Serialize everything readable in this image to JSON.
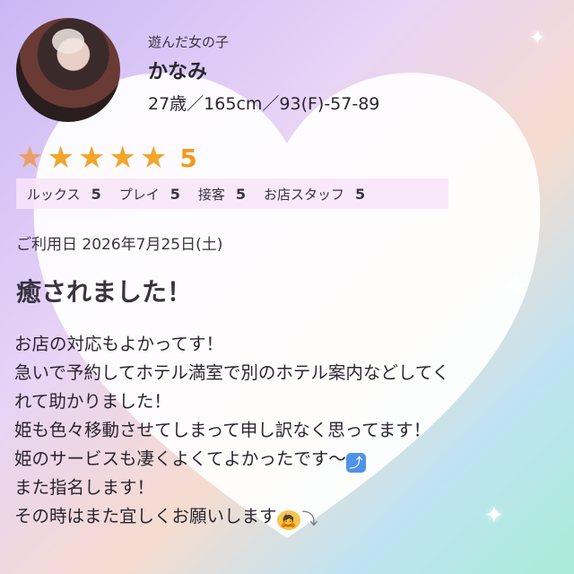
{
  "reviewer": {
    "label": "遊んだ女の子",
    "name": "かなみ",
    "profile": "27歳／165cm／93(F)-57-89"
  },
  "rating": {
    "stars": 5,
    "score": "5",
    "items": [
      {
        "label": "ルックス",
        "value": "5"
      },
      {
        "label": "プレイ",
        "value": "5"
      },
      {
        "label": "接客",
        "value": "5"
      },
      {
        "label": "お店スタッフ",
        "value": "5"
      }
    ]
  },
  "visit_date": "ご利用日 2026年7月25日(土)",
  "title": "癒されました！",
  "body": {
    "lines": [
      "お店の対応もよかってす！",
      "急いで予約してホテル満室で別のホテル案内などしてく",
      "れて助かりました！",
      "姫も色々移動させてしまって申し訳なく思ってます！",
      "姫のサービスも凄くよくてよかったです〜",
      "また指名します！",
      "その時はまた宜しくお願いします"
    ]
  },
  "icons": {
    "arrow_up": "arrow-up-emoji",
    "bowing": "bowing-person-emoji",
    "arrow_down": "arrow-curving-down-emoji"
  }
}
